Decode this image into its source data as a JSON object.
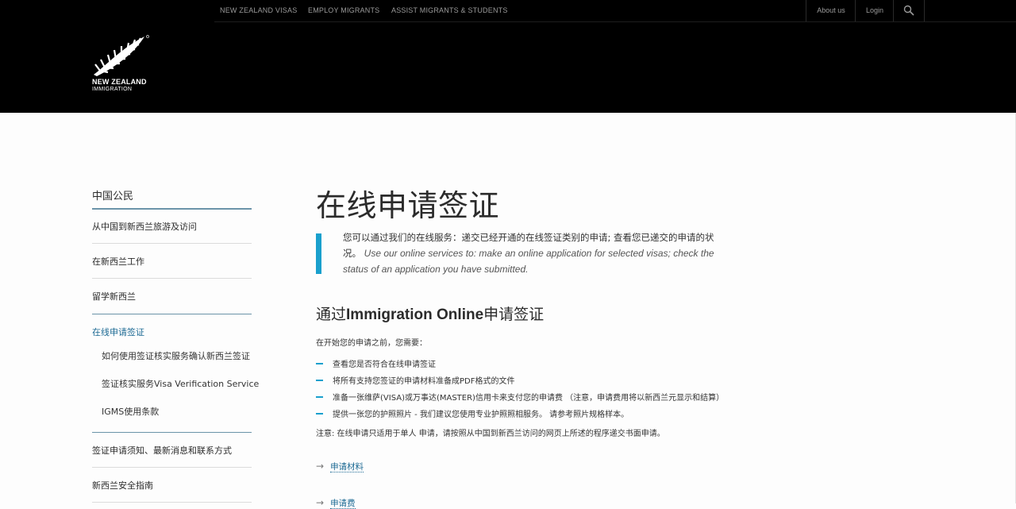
{
  "topnav": {
    "links": [
      "NEW ZEALAND VISAS",
      "EMPLOY MIGRANTS",
      "ASSIST MIGRANTS & STUDENTS"
    ],
    "about": "About us",
    "login": "Login"
  },
  "logo": {
    "line1": "NEW ZEALAND",
    "line2": "IMMIGRATION"
  },
  "sidebar": {
    "heading": "中国公民",
    "items": [
      "从中国到新西兰旅游及访问",
      "在新西兰工作",
      "留学新西兰",
      "在线申请签证"
    ],
    "subitems": [
      "如何使用签证核实服务确认新西兰签证",
      "签证核实服务Visa Verification Service",
      "IGMS使用条款"
    ],
    "more": [
      "签证申请须知、最新消息和联系方式",
      "新西兰安全指南"
    ]
  },
  "main": {
    "title": "在线申请签证",
    "intro_cn": "您可以通过我们的在线服务：递交已经开通的在线签证类别的申请; 查看您已递交的申请的状况。",
    "intro_en": "Use our online services to: make an online application for selected visas; check the status of an application you have submitted.",
    "section_pre": "通过",
    "section_bold": "Immigration Online",
    "section_post": "申请签证",
    "before": "在开始您的申请之前，您需要：",
    "bullets": [
      "查看您是否符合在线申请签证",
      "将所有支持您签证的申请材料准备成PDF格式的文件",
      "准备一张维萨(VISA)或万事达(MASTER)信用卡来支付您的申请费 （注意，申请费用将以新西兰元显示和结算）",
      "提供一张您的护照照片 - 我们建议您使用专业护照照相服务。 请参考照片规格样本。"
    ],
    "note": "注意: 在线申请只适用于单人 申请，请按照从中国到新西兰访问的网页上所述的程序递交书面申请。",
    "links": [
      "申请材料",
      "申请费"
    ]
  }
}
